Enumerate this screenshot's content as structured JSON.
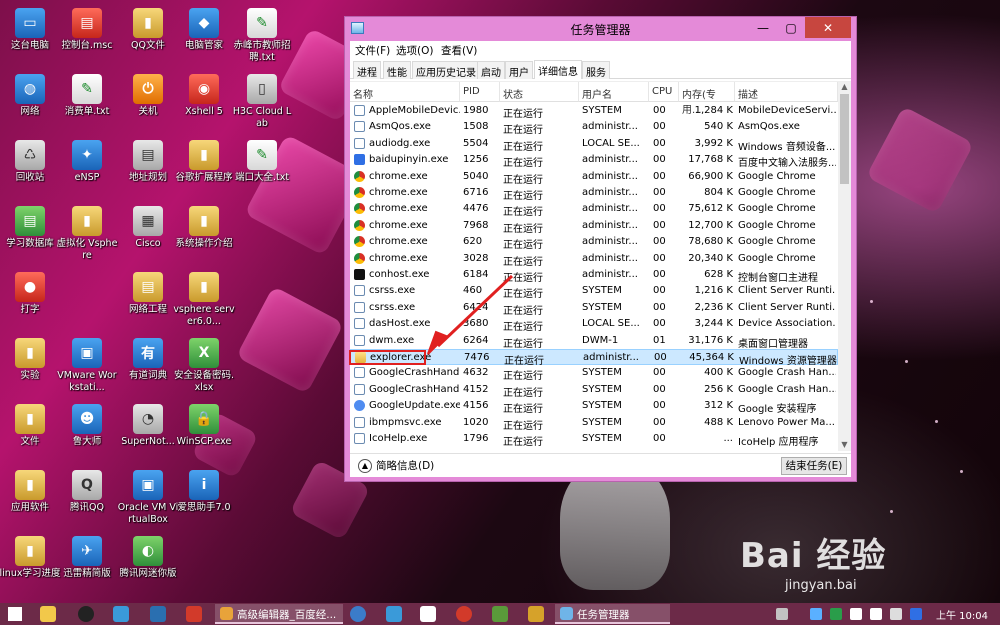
{
  "desktop": {
    "icons": [
      {
        "label": "这台电脑",
        "glyph": "▭",
        "style": "g-blue"
      },
      {
        "label": "控制台.msc",
        "glyph": "▤",
        "style": "g-red"
      },
      {
        "label": "QQ文件",
        "glyph": "▮",
        "style": "g-folder"
      },
      {
        "label": "电脑管家",
        "glyph": "◆",
        "style": "g-blue"
      },
      {
        "label": "赤峰市教师招聘.txt",
        "glyph": "✎",
        "style": "g-doc"
      },
      {
        "label": "网络",
        "glyph": "◍",
        "style": "g-blue"
      },
      {
        "label": "消费单.txt",
        "glyph": "✎",
        "style": "g-doc"
      },
      {
        "label": "关机",
        "glyph": "⏻",
        "style": "g-orange"
      },
      {
        "label": "Xshell 5",
        "glyph": "◉",
        "style": "g-red"
      },
      {
        "label": "H3C Cloud Lab",
        "glyph": "▯",
        "style": "g-gray"
      },
      {
        "label": "回收站",
        "glyph": "♺",
        "style": "g-gray"
      },
      {
        "label": "eNSP",
        "glyph": "✦",
        "style": "g-blue"
      },
      {
        "label": "地址规划",
        "glyph": "▤",
        "style": "g-gray"
      },
      {
        "label": "谷歌扩展程序",
        "glyph": "▮",
        "style": "g-folder"
      },
      {
        "label": "端口大全.txt",
        "glyph": "✎",
        "style": "g-doc"
      },
      {
        "label": "学习数据库",
        "glyph": "▤",
        "style": "g-green"
      },
      {
        "label": "虚拟化 Vsphere",
        "glyph": "▮",
        "style": "g-folder"
      },
      {
        "label": "Cisco",
        "glyph": "▦",
        "style": "g-gray"
      },
      {
        "label": "系统操作介绍",
        "glyph": "▮",
        "style": "g-folder"
      },
      {
        "label": "打字",
        "glyph": "●",
        "style": "g-red"
      },
      {
        "label": "网络工程",
        "glyph": "▤",
        "style": "g-folder"
      },
      {
        "label": "vsphere server6.0...",
        "glyph": "▮",
        "style": "g-folder"
      },
      {
        "label": "实验",
        "glyph": "▮",
        "style": "g-folder"
      },
      {
        "label": "VMware Workstati...",
        "glyph": "▣",
        "style": "g-blue"
      },
      {
        "label": "有道词典",
        "glyph": "有",
        "style": "g-blue"
      },
      {
        "label": "安全设备密码.xlsx",
        "glyph": "X",
        "style": "g-green"
      },
      {
        "label": "文件",
        "glyph": "▮",
        "style": "g-folder"
      },
      {
        "label": "鲁大师",
        "glyph": "☻",
        "style": "g-blue"
      },
      {
        "label": "SuperNot...",
        "glyph": "◔",
        "style": "g-gray"
      },
      {
        "label": "WinSCP.exe",
        "glyph": "🔒",
        "style": "g-green"
      },
      {
        "label": "应用软件",
        "glyph": "▮",
        "style": "g-folder"
      },
      {
        "label": "腾讯QQ",
        "glyph": "Q",
        "style": "g-gray"
      },
      {
        "label": "Oracle VM VirtualBox",
        "glyph": "▣",
        "style": "g-blue"
      },
      {
        "label": "爱思助手7.0",
        "glyph": "i",
        "style": "g-blue"
      },
      {
        "label": "linux学习进度",
        "glyph": "▮",
        "style": "g-folder"
      },
      {
        "label": "迅雷精简版",
        "glyph": "✈",
        "style": "g-blue"
      },
      {
        "label": "腾讯网迷你版",
        "glyph": "◐",
        "style": "g-green"
      }
    ],
    "watermark": "Bai 经验",
    "watermark_url": "jingyan.bai"
  },
  "window": {
    "title": "任务管理器",
    "controls": {
      "minimize": "—",
      "maximize": "▢",
      "close": "✕"
    },
    "menu": [
      "文件(F)",
      "选项(O)",
      "查看(V)"
    ],
    "tabs": [
      "进程",
      "性能",
      "应用历史记录",
      "启动",
      "用户",
      "详细信息",
      "服务"
    ],
    "active_tab": "详细信息",
    "columns": [
      "名称",
      "PID",
      "状态",
      "用户名",
      "CPU",
      "内存(专用...",
      "描述"
    ],
    "rows": [
      {
        "name": "AppleMobileDevic...",
        "pid": "1980",
        "status": "正在运行",
        "user": "SYSTEM",
        "cpu": "00",
        "mem": "1,284 K",
        "desc": "MobileDeviceServi...",
        "icon": "pi-app"
      },
      {
        "name": "AsmQos.exe",
        "pid": "1508",
        "status": "正在运行",
        "user": "administr...",
        "cpu": "00",
        "mem": "540 K",
        "desc": "AsmQos.exe",
        "icon": "pi-app"
      },
      {
        "name": "audiodg.exe",
        "pid": "5504",
        "status": "正在运行",
        "user": "LOCAL SE...",
        "cpu": "00",
        "mem": "3,992 K",
        "desc": "Windows 音频设备...",
        "icon": "pi-app"
      },
      {
        "name": "baidupinyin.exe",
        "pid": "1256",
        "status": "正在运行",
        "user": "administr...",
        "cpu": "00",
        "mem": "17,768 K",
        "desc": "百度中文输入法服务...",
        "icon": "pi-du"
      },
      {
        "name": "chrome.exe",
        "pid": "5040",
        "status": "正在运行",
        "user": "administr...",
        "cpu": "00",
        "mem": "66,900 K",
        "desc": "Google Chrome",
        "icon": "pi-chrome"
      },
      {
        "name": "chrome.exe",
        "pid": "6716",
        "status": "正在运行",
        "user": "administr...",
        "cpu": "00",
        "mem": "804 K",
        "desc": "Google Chrome",
        "icon": "pi-chrome"
      },
      {
        "name": "chrome.exe",
        "pid": "4476",
        "status": "正在运行",
        "user": "administr...",
        "cpu": "00",
        "mem": "75,612 K",
        "desc": "Google Chrome",
        "icon": "pi-chrome"
      },
      {
        "name": "chrome.exe",
        "pid": "7968",
        "status": "正在运行",
        "user": "administr...",
        "cpu": "00",
        "mem": "12,700 K",
        "desc": "Google Chrome",
        "icon": "pi-chrome"
      },
      {
        "name": "chrome.exe",
        "pid": "620",
        "status": "正在运行",
        "user": "administr...",
        "cpu": "00",
        "mem": "78,680 K",
        "desc": "Google Chrome",
        "icon": "pi-chrome"
      },
      {
        "name": "chrome.exe",
        "pid": "3028",
        "status": "正在运行",
        "user": "administr...",
        "cpu": "00",
        "mem": "20,340 K",
        "desc": "Google Chrome",
        "icon": "pi-chrome"
      },
      {
        "name": "conhost.exe",
        "pid": "6184",
        "status": "正在运行",
        "user": "administr...",
        "cpu": "00",
        "mem": "628 K",
        "desc": "控制台窗口主进程",
        "icon": "pi-cmd"
      },
      {
        "name": "csrss.exe",
        "pid": "460",
        "status": "正在运行",
        "user": "SYSTEM",
        "cpu": "00",
        "mem": "1,216 K",
        "desc": "Client Server Runti...",
        "icon": "pi-app"
      },
      {
        "name": "csrss.exe",
        "pid": "6424",
        "status": "正在运行",
        "user": "SYSTEM",
        "cpu": "00",
        "mem": "2,236 K",
        "desc": "Client Server Runti...",
        "icon": "pi-app"
      },
      {
        "name": "dasHost.exe",
        "pid": "3680",
        "status": "正在运行",
        "user": "LOCAL SE...",
        "cpu": "00",
        "mem": "3,244 K",
        "desc": "Device Association...",
        "icon": "pi-app"
      },
      {
        "name": "dwm.exe",
        "pid": "6264",
        "status": "正在运行",
        "user": "DWM-1",
        "cpu": "01",
        "mem": "31,176 K",
        "desc": "桌面窗口管理器",
        "icon": "pi-app"
      },
      {
        "name": "explorer.exe",
        "pid": "7476",
        "status": "正在运行",
        "user": "administr...",
        "cpu": "00",
        "mem": "45,364 K",
        "desc": "Windows 资源管理器",
        "icon": "pi-exp",
        "selected": true
      },
      {
        "name": "GoogleCrashHandl...",
        "pid": "4632",
        "status": "正在运行",
        "user": "SYSTEM",
        "cpu": "00",
        "mem": "400 K",
        "desc": "Google Crash Han...",
        "icon": "pi-app"
      },
      {
        "name": "GoogleCrashHandl...",
        "pid": "4152",
        "status": "正在运行",
        "user": "SYSTEM",
        "cpu": "00",
        "mem": "256 K",
        "desc": "Google Crash Han...",
        "icon": "pi-app"
      },
      {
        "name": "GoogleUpdate.exe",
        "pid": "4156",
        "status": "正在运行",
        "user": "SYSTEM",
        "cpu": "00",
        "mem": "312 K",
        "desc": "Google 安装程序",
        "icon": "pi-gup"
      },
      {
        "name": "ibmpmsvc.exe",
        "pid": "1020",
        "status": "正在运行",
        "user": "SYSTEM",
        "cpu": "00",
        "mem": "488 K",
        "desc": "Lenovo Power Ma...",
        "icon": "pi-app"
      },
      {
        "name": "IcoHelp.exe",
        "pid": "1796",
        "status": "正在运行",
        "user": "SYSTEM",
        "cpu": "00",
        "mem": "...",
        "desc": "IcoHelp 应用程序",
        "icon": "pi-app"
      }
    ],
    "footer": {
      "less_details": "简略信息(D)",
      "end_task": "结束任务(E)"
    }
  },
  "taskbar": {
    "apps": [
      {
        "label": "高级编辑器_百度经...",
        "color": "#e8a33a"
      },
      {
        "label": "任务管理器",
        "color": "#6fb4e8"
      }
    ],
    "clock": "上午 10:04"
  }
}
